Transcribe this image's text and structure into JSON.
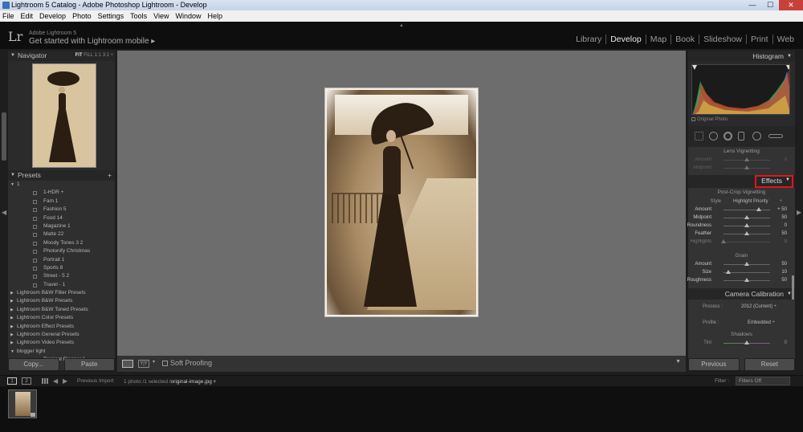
{
  "window": {
    "title": "Lightroom 5 Catalog - Adobe Photoshop Lightroom - Develop",
    "controls": [
      "—",
      "☐",
      "✕"
    ]
  },
  "menu": [
    "File",
    "Edit",
    "Develop",
    "Photo",
    "Settings",
    "Tools",
    "View",
    "Window",
    "Help"
  ],
  "identity": {
    "logo": "Lr",
    "small": "Adobe Lightroom 5",
    "big": "Get started with Lightroom mobile  ▸"
  },
  "modules": [
    "Library",
    "Develop",
    "Map",
    "Book",
    "Slideshow",
    "Print",
    "Web"
  ],
  "active_module": "Develop",
  "navigator": {
    "title": "Navigator",
    "zoom_fit": "FIT",
    "zoom_other": "FILL  1:1  3:1 ÷"
  },
  "presets": {
    "title": "Presets",
    "add": "+",
    "items": [
      {
        "label": "1",
        "level": 0,
        "expanded": true
      },
      {
        "label": "1-HDR +",
        "level": 1
      },
      {
        "label": "Fam 1",
        "level": 1
      },
      {
        "label": "Fashion 5",
        "level": 1
      },
      {
        "label": "Food 14",
        "level": 1
      },
      {
        "label": "Magazine 1",
        "level": 1
      },
      {
        "label": "Matte 22",
        "level": 1
      },
      {
        "label": "Moody Tones 3 2",
        "level": 1
      },
      {
        "label": "Photonify Christmas",
        "level": 1
      },
      {
        "label": "Portrait 1",
        "level": 1
      },
      {
        "label": "Sports 8",
        "level": 1
      },
      {
        "label": "Street - 5 2",
        "level": 1
      },
      {
        "label": "Travel - 1",
        "level": 1
      },
      {
        "label": "Lightroom B&W Filter Presets",
        "level": 0,
        "expanded": false
      },
      {
        "label": "Lightroom B&W Presets",
        "level": 0,
        "expanded": false
      },
      {
        "label": "Lightroom B&W Toned Presets",
        "level": 0,
        "expanded": false
      },
      {
        "label": "Lightroom Color Presets",
        "level": 0,
        "expanded": false
      },
      {
        "label": "Lightroom Effect Presets",
        "level": 0,
        "expanded": false
      },
      {
        "label": "Lightroom General Presets",
        "level": 0,
        "expanded": false
      },
      {
        "label": "Lightroom Video Presets",
        "level": 0,
        "expanded": false
      },
      {
        "label": "blogger light",
        "level": 0,
        "expanded": true
      },
      {
        "label": "Tropical Blogger 1",
        "level": 1
      }
    ]
  },
  "left_buttons": {
    "copy": "Copy...",
    "paste": "Paste"
  },
  "toolbar": {
    "soft_proofing": "Soft Proofing",
    "compare_glyph": "Y|Y"
  },
  "histogram": {
    "title": "Histogram",
    "original_photo": "Original Photo"
  },
  "lens_vignetting": {
    "title": "Lens Vignetting",
    "sliders": [
      {
        "label": "Amount",
        "value": "0",
        "pos": 0.5
      },
      {
        "label": "Midpoint",
        "value": "",
        "pos": 0.5
      }
    ]
  },
  "effects": {
    "title": "Effects",
    "post_crop": "Post-Crop Vignetting",
    "style_label": "Style",
    "style_value": "Highlight Priority",
    "style_caret": "÷",
    "sliders": [
      {
        "label": "Amount",
        "value": "+ 50",
        "pos": 0.75
      },
      {
        "label": "Midpoint",
        "value": "50",
        "pos": 0.5
      },
      {
        "label": "Roundness",
        "value": "0",
        "pos": 0.5
      },
      {
        "label": "Feather",
        "value": "50",
        "pos": 0.5
      },
      {
        "label": "Highlights",
        "value": "0",
        "pos": 0
      }
    ],
    "grain_title": "Grain",
    "grain_sliders": [
      {
        "label": "Amount",
        "value": "50",
        "pos": 0.5
      },
      {
        "label": "Size",
        "value": "10",
        "pos": 0.1
      },
      {
        "label": "Roughness",
        "value": "50",
        "pos": 0.5
      }
    ]
  },
  "camera_calibration": {
    "title": "Camera Calibration",
    "process_label": "Process :",
    "process_value": "2012 (Current) ÷",
    "profile_label": "Profile :",
    "profile_value": "Embedded ÷",
    "shadows_title": "Shadows",
    "tint_label": "Tint",
    "tint_value": "0",
    "tint_pos": 0.5
  },
  "right_buttons": {
    "previous": "Previous",
    "reset": "Reset"
  },
  "filmstrip_bar": {
    "monitor1": "1",
    "monitor2": "2",
    "previous_import": "Previous Import",
    "selection_prefix": "1 photo /1 selected /",
    "filename": "original-image.jpg",
    "filename_caret": "▾",
    "filter_label": "Filter :",
    "filter_value": "Filters Off"
  }
}
